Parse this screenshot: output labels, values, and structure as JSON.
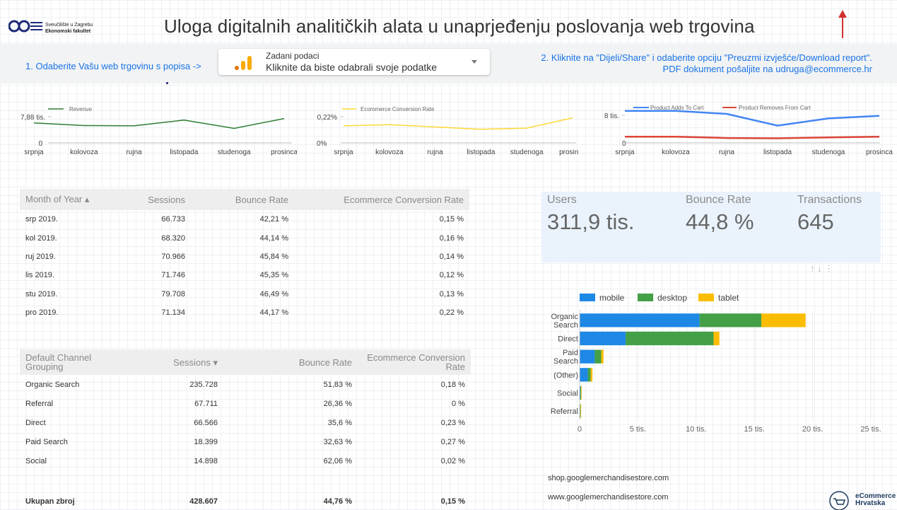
{
  "header": {
    "logo_line1": "Sveučilište u Zagrebu",
    "logo_line2": "Ekonomski fakultet",
    "title": "Uloga digitalnih analitičkih alata u unaprjeđenju poslovanja web trgovina"
  },
  "instructions": {
    "step1": "1. Odaberite Vašu web trgovinu s popisa ->",
    "picker_label": "Zadani podaci",
    "picker_value": "Kliknite da biste odabrali svoje podatke",
    "step2_line1": "2. Kliknite na \"Dijeli/Share\" i odaberite opciju \"Preuzmi izvješće/Download report\".",
    "step2_line2": "PDF dokument pošaljite na udruga@ecommerce.hr"
  },
  "colors": {
    "accent_blue": "#1a73e8",
    "revenue_green": "#2e7d32",
    "conversion_yellow": "#fdd835",
    "adds_blue": "#4285f4",
    "removes_red": "#db4437",
    "mobile": "#1e88e5",
    "desktop": "#43a047",
    "tablet": "#fbbc04"
  },
  "sparklines": {
    "months": [
      "srpnja",
      "kolovoza",
      "rujna",
      "listopada",
      "studenoga",
      "prosinca"
    ],
    "revenue": {
      "legend": "Revenue",
      "y_top_label": "7,88 tis.",
      "y_bottom_label": "0",
      "values": [
        6900,
        6000,
        5900,
        7900,
        5000,
        8400
      ]
    },
    "conversion": {
      "legend": "Ecommerce Conversion Rate",
      "y_top_label": "0,22%",
      "y_bottom_label": "0%",
      "values": [
        0.15,
        0.16,
        0.14,
        0.12,
        0.13,
        0.22
      ]
    },
    "cart": {
      "legend_adds": "Product Adds To Cart",
      "legend_removes": "Product Removes From Cart",
      "y_top_label": "8 tis.",
      "y_bottom_label": "0",
      "adds": [
        9800,
        9800,
        8900,
        5300,
        7500,
        8300
      ],
      "removes": [
        1900,
        1900,
        1500,
        1400,
        1700,
        1900
      ]
    }
  },
  "month_table": {
    "headers": [
      "Month of Year ▴",
      "Sessions",
      "Bounce Rate",
      "Ecommerce Conversion Rate"
    ],
    "rows": [
      [
        "srp 2019.",
        "66.733",
        "42,21 %",
        "0,15 %"
      ],
      [
        "kol 2019.",
        "68.320",
        "44,14 %",
        "0,16 %"
      ],
      [
        "ruj 2019.",
        "70.966",
        "45,84 %",
        "0,14 %"
      ],
      [
        "lis 2019.",
        "71.746",
        "45,35 %",
        "0,12 %"
      ],
      [
        "stu 2019.",
        "79.708",
        "46,49 %",
        "0,13 %"
      ],
      [
        "pro 2019.",
        "71.134",
        "44,17 %",
        "0,22 %"
      ]
    ]
  },
  "channel_table": {
    "headers": [
      "Default Channel Grouping",
      "Sessions ▾",
      "Bounce Rate",
      "Ecommerce Conversion Rate"
    ],
    "rows": [
      [
        "Organic Search",
        "235.728",
        "51,83 %",
        "0,18 %"
      ],
      [
        "Referral",
        "67.711",
        "26,36 %",
        "0 %"
      ],
      [
        "Direct",
        "66.566",
        "35,6 %",
        "0,23 %"
      ],
      [
        "Paid Search",
        "18.399",
        "32,63 %",
        "0,27 %"
      ],
      [
        "Social",
        "14.898",
        "62,06 %",
        "0,02 %"
      ]
    ],
    "total": [
      "Ukupan zbroj",
      "428.607",
      "44,76 %",
      "0,15 %"
    ]
  },
  "kpis": {
    "users_label": "Users",
    "users_value": "311,9 tis.",
    "bounce_label": "Bounce Rate",
    "bounce_value": "44,8 %",
    "transactions_label": "Transactions",
    "transactions_value": "645"
  },
  "card_controls": "↑ ↓ ⋮",
  "chart_data": {
    "type": "bar",
    "orientation": "horizontal",
    "stacked": true,
    "categories": [
      "Organic Search",
      "Direct",
      "Paid Search",
      "(Other)",
      "Social",
      "Referral"
    ],
    "series": [
      {
        "name": "mobile",
        "values": [
          10300,
          3950,
          1300,
          700,
          60,
          40
        ]
      },
      {
        "name": "desktop",
        "values": [
          5300,
          7550,
          550,
          250,
          60,
          40
        ]
      },
      {
        "name": "tablet",
        "values": [
          3800,
          500,
          200,
          150,
          10,
          10
        ]
      }
    ],
    "x_tick_labels": [
      "0",
      "5 tis.",
      "10 tis.",
      "15 tis.",
      "20 tis.",
      "25 tis."
    ],
    "xlim": [
      0,
      25000
    ],
    "legend_position": "top"
  },
  "sites": [
    "shop.googlemerchandisestore.com",
    "www.googlemerchandisestore.com"
  ],
  "ecom_logo": {
    "line1": "eCommerce",
    "line2": "Hrvatska"
  }
}
